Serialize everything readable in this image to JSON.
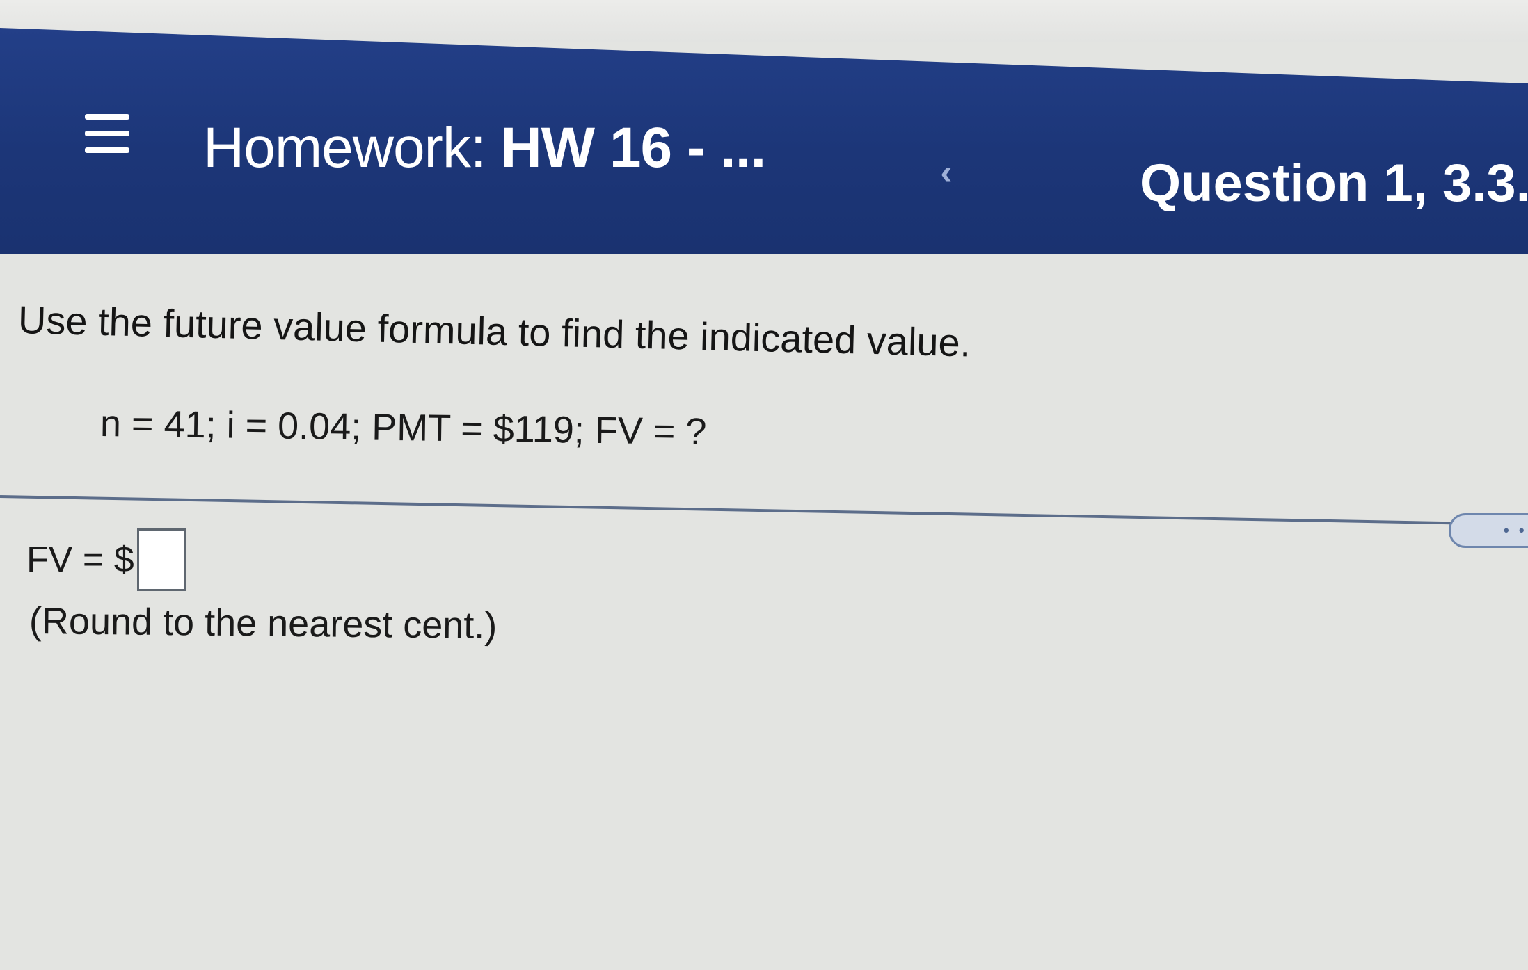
{
  "header": {
    "menu_icon": "hamburger-menu-icon",
    "title_prefix": "Homework:",
    "title_main": "HW 16 - ...",
    "back_icon": "chevron-left-icon",
    "back_glyph": "‹",
    "question_label": "Question 1, 3.3."
  },
  "question": {
    "instruction": "Use the future value formula to find the indicated value.",
    "given": "n = 41; i = 0.04; PMT = $119; FV = ?"
  },
  "more_toggle": {
    "icon": "more-dots-icon",
    "label": "• •"
  },
  "answer": {
    "label": "FV = $",
    "value": "",
    "note": "(Round to the nearest cent.)"
  },
  "colors": {
    "header_bg": "#1c3678",
    "page_bg": "#e3e4e1",
    "divider": "#5c6d8a"
  }
}
